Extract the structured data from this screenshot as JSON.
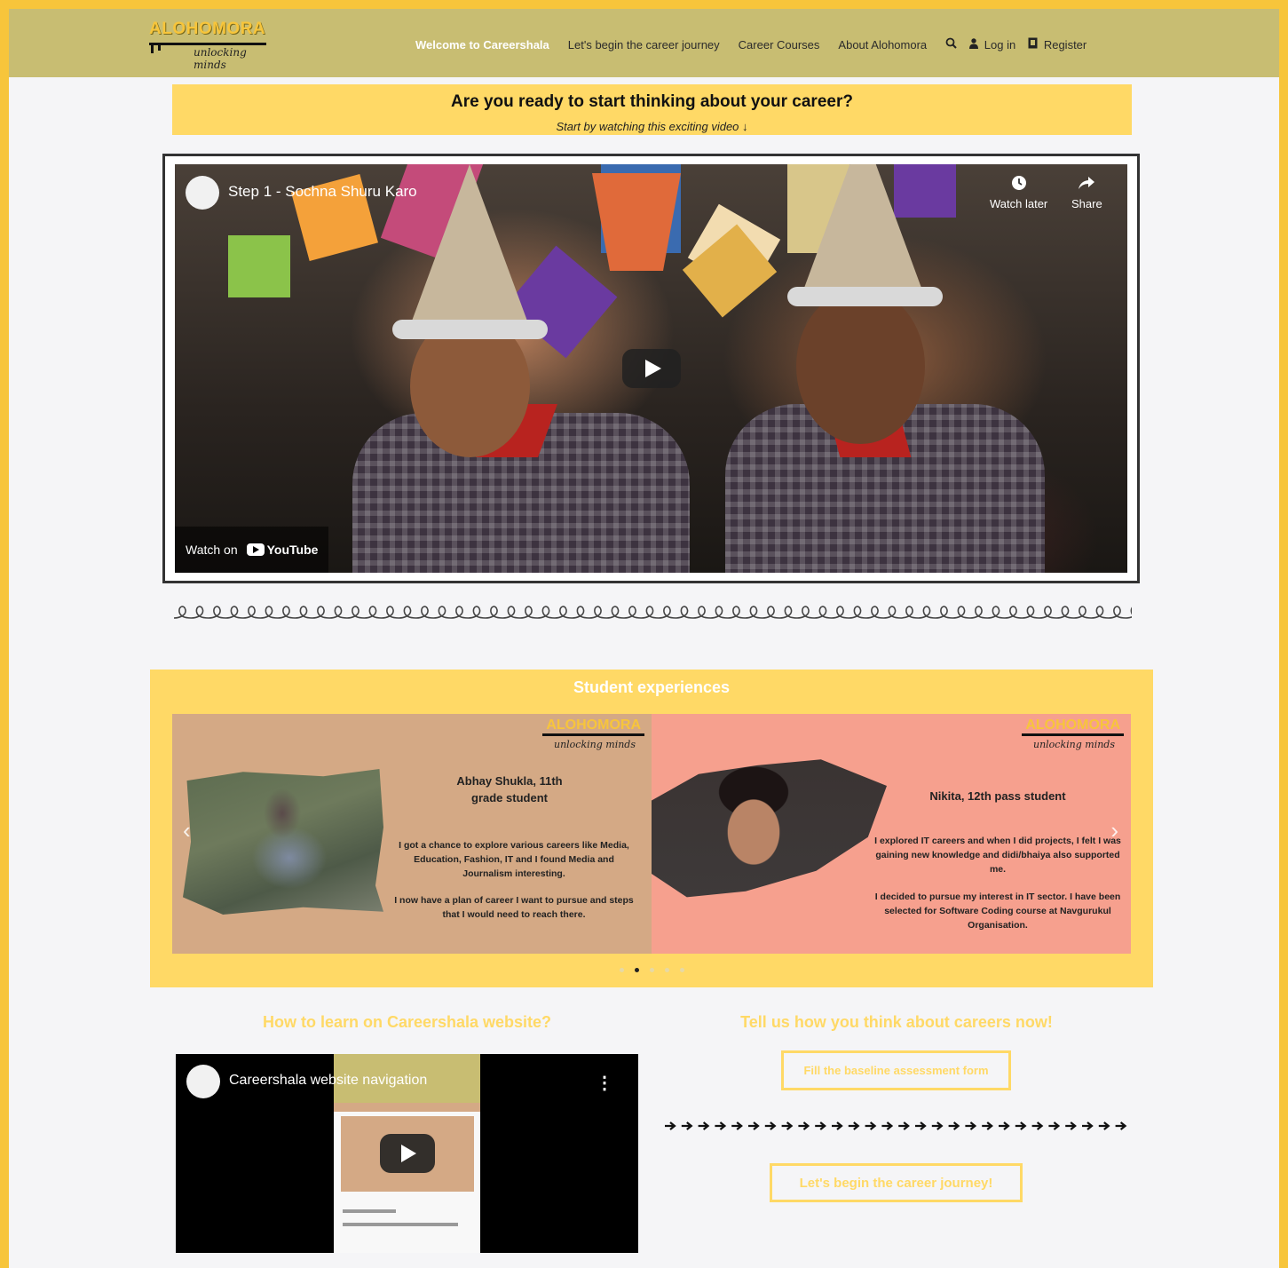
{
  "header": {
    "logo_title": "ALOHOMORA",
    "logo_subtitle": "unlocking minds",
    "nav": [
      {
        "label": "Welcome to Careershala",
        "active": true
      },
      {
        "label": "Let's begin the career journey",
        "active": false
      },
      {
        "label": "Career Courses",
        "active": false
      },
      {
        "label": "About Alohomora",
        "active": false
      }
    ],
    "login_label": "Log in",
    "register_label": "Register"
  },
  "banner": {
    "title": "Are you ready to start thinking about your career?",
    "subtitle": "Start by watching this exciting video ↓"
  },
  "main_video": {
    "title": "Step 1 - Sochna Shuru Karo",
    "watch_later": "Watch later",
    "share": "Share",
    "watch_on": "Watch on",
    "youtube": "YouTube"
  },
  "experiences": {
    "title": "Student experiences",
    "cards": [
      {
        "name": "Abhay Shukla, 11th grade student",
        "text1": "I got a chance to explore various careers like Media, Education, Fashion, IT and I found Media and Journalism interesting.",
        "text2": "I now have a plan of career I want to pursue and steps that I would need to reach there.",
        "logo_title": "ALOHOMORA",
        "logo_subtitle": "unlocking minds"
      },
      {
        "name": "Nikita, 12th pass student",
        "text1": "I explored IT careers and when I did projects, I felt I was gaining new knowledge and didi/bhaiya also supported me.",
        "text2": "I decided to pursue my interest in IT sector. I have been selected for Software Coding course at Navgurukul Organisation.",
        "logo_title": "ALOHOMORA",
        "logo_subtitle": "unlocking minds"
      }
    ],
    "dot_count": 5,
    "active_dot": 1
  },
  "learn": {
    "title": "How to learn on Careershala website?",
    "video_title": "Careershala website navigation"
  },
  "tell": {
    "title": "Tell us how you think about careers now!",
    "assessment_button": "Fill the baseline assessment form",
    "journey_button": "Let's begin the career journey!"
  },
  "colors": {
    "border": "#f7c53b",
    "header": "#c8bd72",
    "accent": "#ffd966",
    "card_a": "#d4a985",
    "card_b": "#f6a08e"
  }
}
